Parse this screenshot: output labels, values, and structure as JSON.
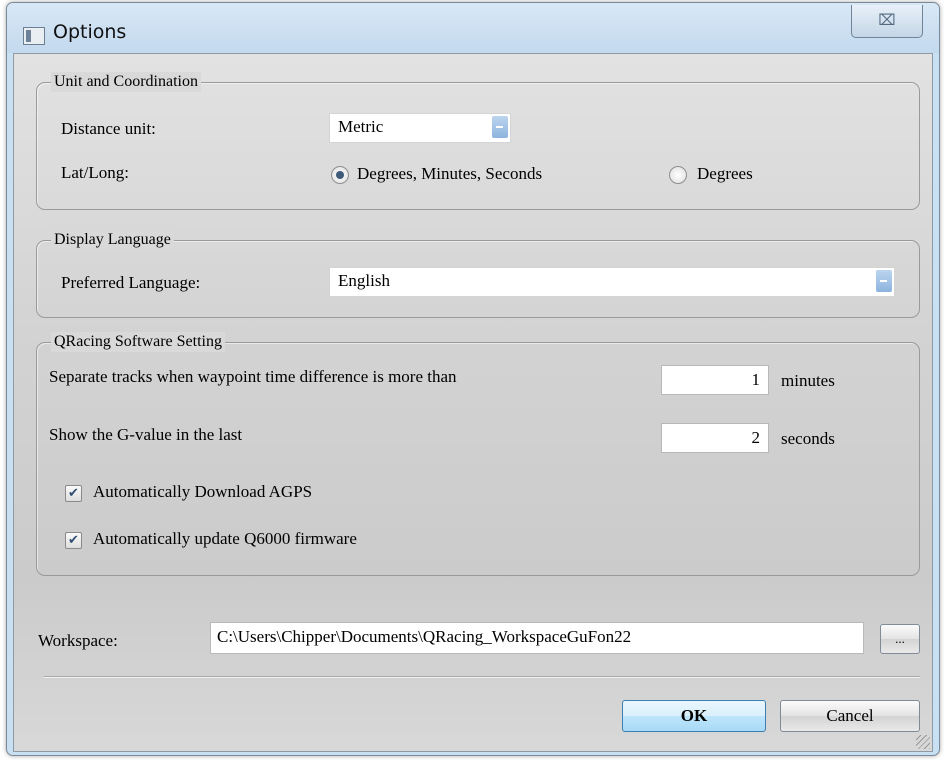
{
  "window": {
    "title": "Options",
    "close_glyph": "⌧"
  },
  "unit_group": {
    "legend": "Unit and Coordination",
    "distance_label": "Distance unit:",
    "distance_value": "Metric",
    "latlong_label": "Lat/Long:",
    "radio_dms_label": "Degrees, Minutes, Seconds",
    "radio_deg_label": "Degrees",
    "selected": "Degrees, Minutes, Seconds"
  },
  "language_group": {
    "legend": "Display Language",
    "preferred_label": "Preferred Language:",
    "preferred_value": "English"
  },
  "software_group": {
    "legend": "QRacing Software Setting",
    "separate_label": "Separate tracks when waypoint time difference is more than",
    "separate_value": "1",
    "separate_unit": "minutes",
    "gvalue_label": "Show the G-value in the last",
    "gvalue_value": "2",
    "gvalue_unit": "seconds",
    "agps_label": "Automatically Download AGPS",
    "agps_checked": true,
    "firmware_label": "Automatically update Q6000 firmware",
    "firmware_checked": true
  },
  "workspace": {
    "label": "Workspace:",
    "path": "C:\\Users\\Chipper\\Documents\\QRacing_WorkspaceGuFon22",
    "browse_label": "..."
  },
  "footer": {
    "ok_label": "OK",
    "cancel_label": "Cancel"
  },
  "colors": {
    "accent": "#3c7fb1",
    "frame": "#c9dff2",
    "panel": "#d3d3d3"
  }
}
